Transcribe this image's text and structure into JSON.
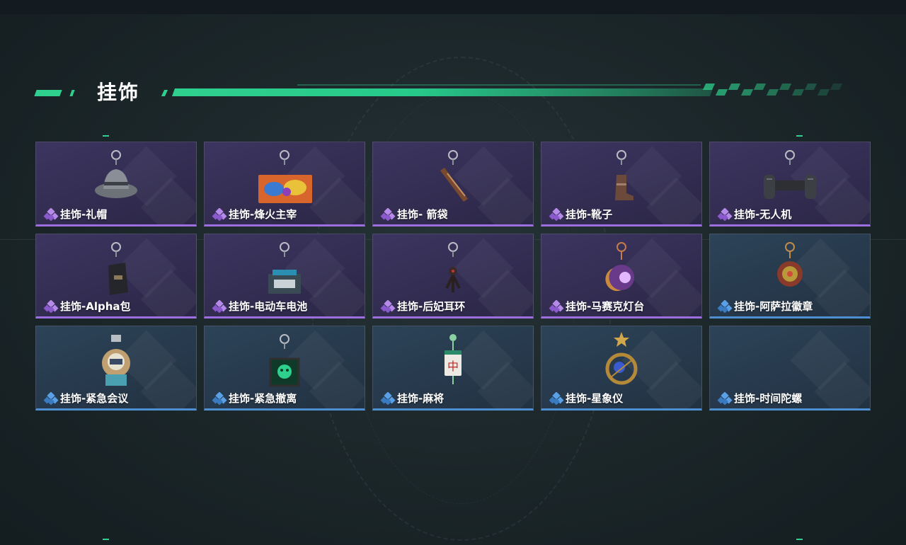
{
  "section": {
    "title": "挂饰"
  },
  "colors": {
    "accent": "#2fd08e",
    "epic": "#9d6ee0",
    "rare": "#4d8fd0"
  },
  "items": [
    {
      "name": "挂饰-礼帽",
      "rarity": "epic",
      "icon": "fedora-hat-icon"
    },
    {
      "name": "挂饰-烽火主宰",
      "rarity": "epic",
      "icon": "graffiti-tag-icon"
    },
    {
      "name": "挂饰- 箭袋",
      "rarity": "epic",
      "icon": "quiver-icon"
    },
    {
      "name": "挂饰-靴子",
      "rarity": "epic",
      "icon": "boot-icon"
    },
    {
      "name": "挂饰-无人机",
      "rarity": "epic",
      "icon": "drone-icon"
    },
    {
      "name": "挂饰-Alpha包",
      "rarity": "epic",
      "icon": "pouch-icon"
    },
    {
      "name": "挂饰-电动车电池",
      "rarity": "epic",
      "icon": "battery-icon"
    },
    {
      "name": "挂饰-后妃耳环",
      "rarity": "epic",
      "icon": "earring-icon"
    },
    {
      "name": "挂饰-马赛克灯台",
      "rarity": "epic",
      "icon": "mosaic-lamp-icon"
    },
    {
      "name": "挂饰-阿萨拉徽章",
      "rarity": "rare",
      "icon": "badge-icon"
    },
    {
      "name": "挂饰-紧急会议",
      "rarity": "rare",
      "icon": "meeting-figure-icon"
    },
    {
      "name": "挂饰-紧急撤离",
      "rarity": "rare",
      "icon": "evac-sign-icon"
    },
    {
      "name": "挂饰-麻将",
      "rarity": "rare",
      "icon": "mahjong-tile-icon"
    },
    {
      "name": "挂饰-星象仪",
      "rarity": "rare",
      "icon": "astrolabe-icon"
    },
    {
      "name": "挂饰-时间陀螺",
      "rarity": "rare",
      "icon": "gyroscope-icon"
    }
  ]
}
